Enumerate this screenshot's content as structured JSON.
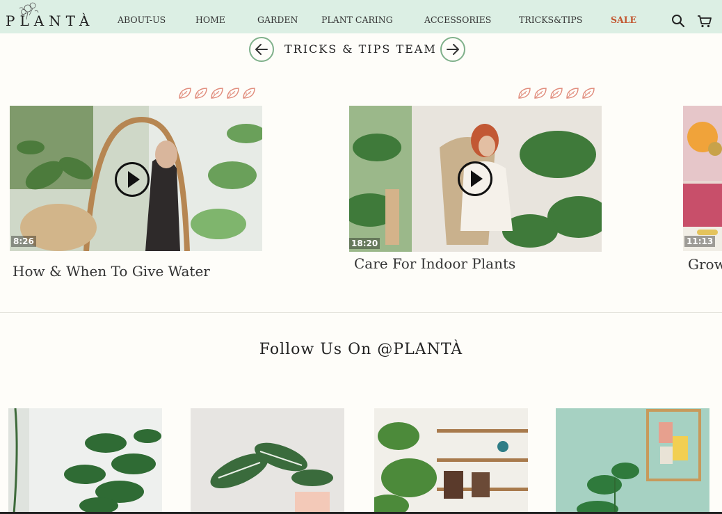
{
  "brand": {
    "name": "PLANTÀ"
  },
  "nav": {
    "items": [
      {
        "label": "ABOUT-US"
      },
      {
        "label": "HOME"
      },
      {
        "label": "GARDEN"
      },
      {
        "label": "PLANT CARING"
      },
      {
        "label": "ACCESSORIES"
      },
      {
        "label": "TRICKS&TIPS"
      },
      {
        "label": "SALE"
      }
    ],
    "icons": [
      "search-icon",
      "cart-icon"
    ],
    "sale_color": "#c2552e"
  },
  "section": {
    "title": "TRICKS & TIPS TEAM"
  },
  "videos": [
    {
      "duration": "8:26",
      "title": "How & When To Give Water",
      "rating": 5
    },
    {
      "duration": "18:20",
      "title": "Care For Indoor Plants",
      "rating": 5
    },
    {
      "duration": "11:13",
      "title": "Grow"
    }
  ],
  "follow": {
    "title": "Follow Us On @PLANTÀ"
  },
  "colors": {
    "header_bg": "#dcefe4",
    "accent_green": "#7fb08a",
    "leaf": "#e08a7a"
  }
}
